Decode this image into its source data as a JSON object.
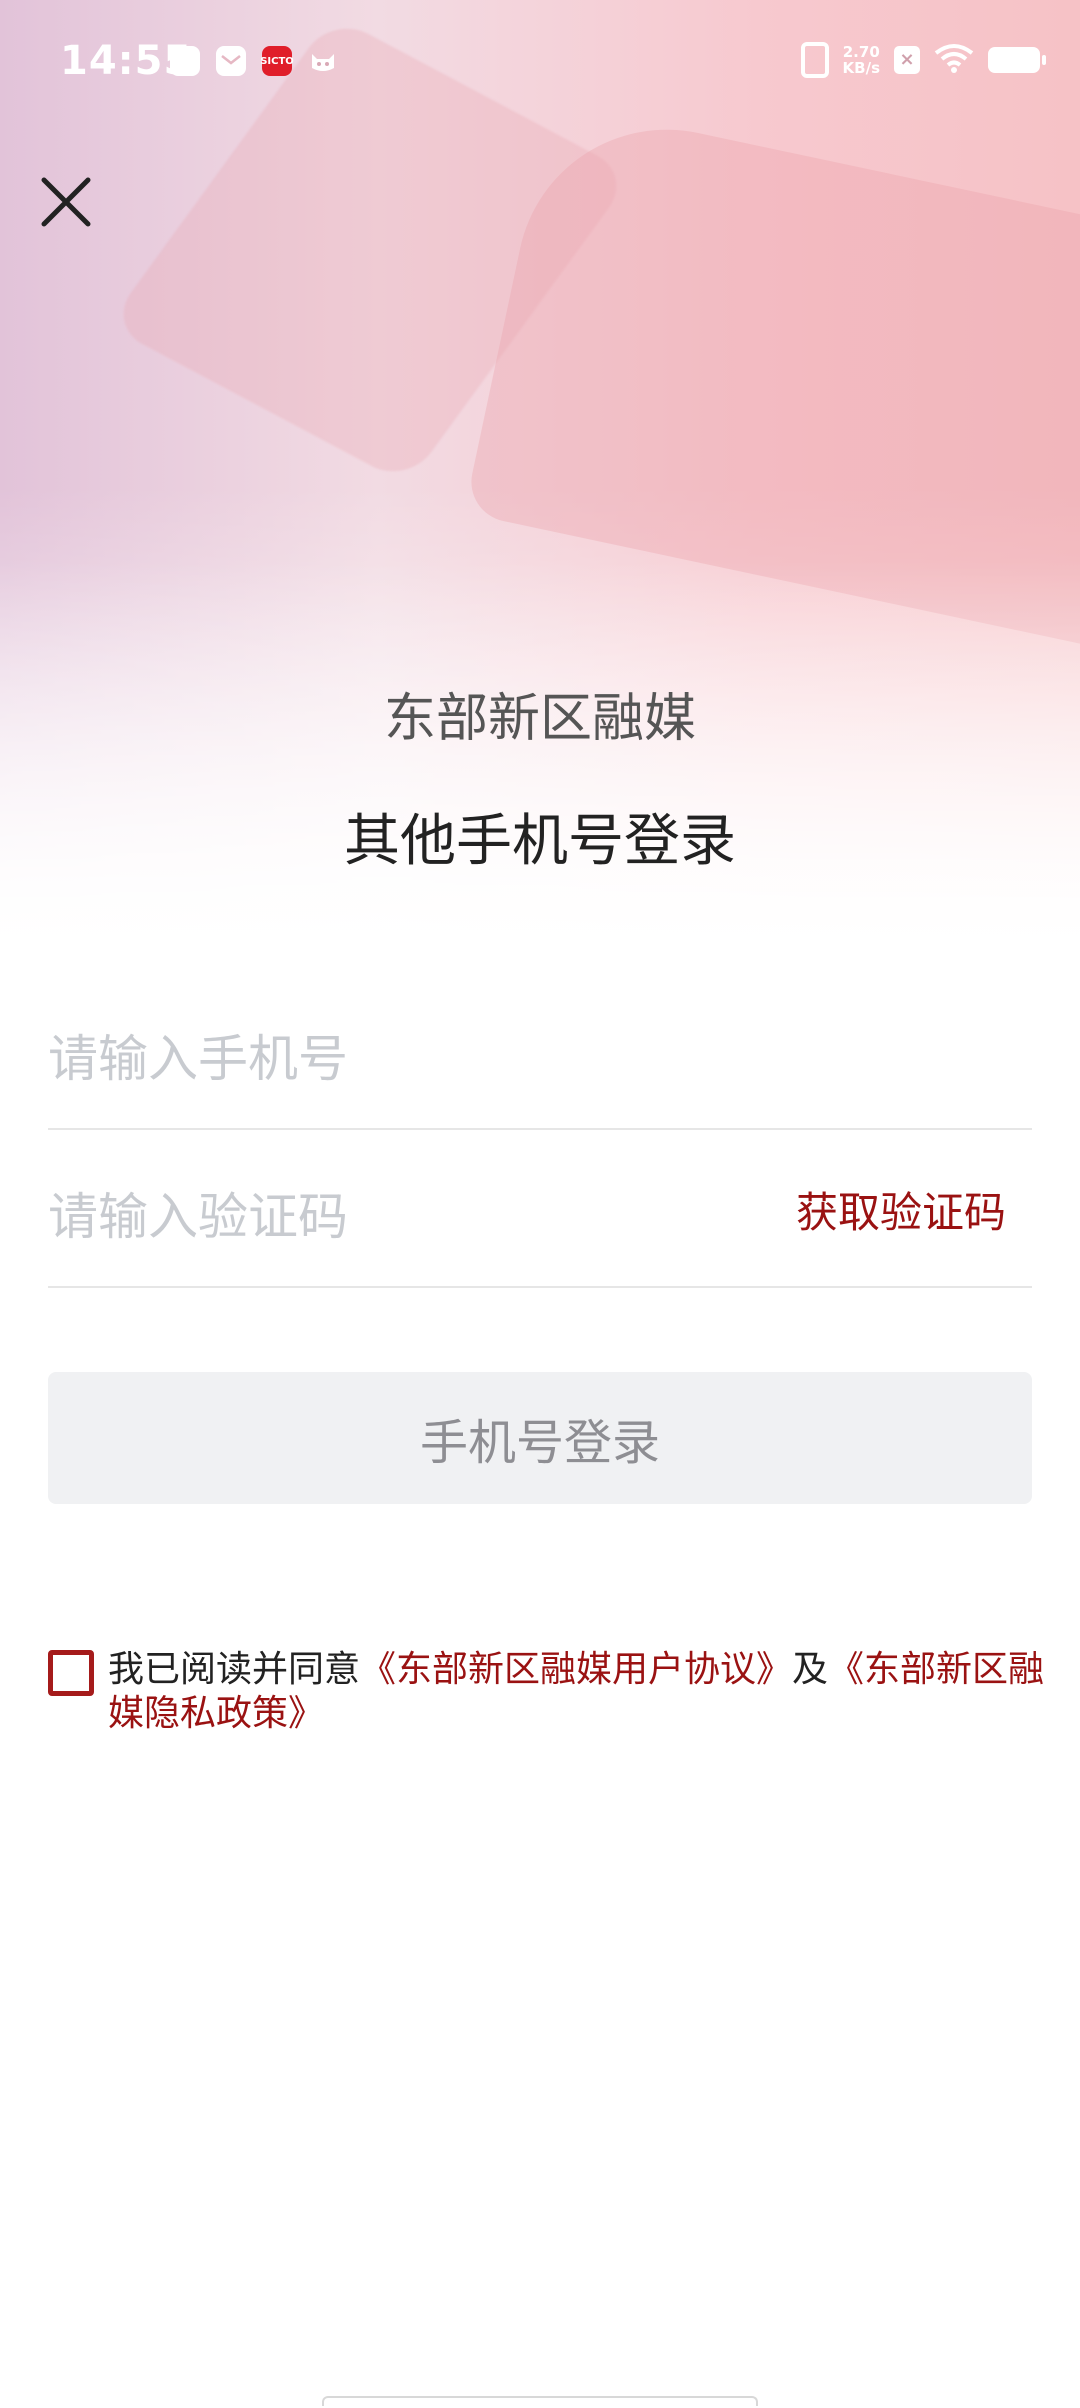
{
  "status_bar": {
    "time": "14:55",
    "notif_icon_3": "SICTO",
    "net_speed_value": "2.70",
    "net_speed_unit": "KB/s"
  },
  "header": {
    "brand": "东部新区融媒",
    "title": "其他手机号登录"
  },
  "form": {
    "phone_placeholder": "请输入手机号",
    "code_placeholder": "请输入验证码",
    "get_code_label": "获取验证码",
    "login_label": "手机号登录"
  },
  "agreement": {
    "prefix": "我已阅读并同意",
    "user_agreement": "《东部新区融媒用户协议》",
    "and": "及",
    "privacy_policy": "《东部新区融媒隐私政策》"
  },
  "colors": {
    "accent": "#9a1212",
    "placeholder": "#c8cbd0",
    "button_bg": "#f0f1f3"
  },
  "icons": [
    "close-icon",
    "checkbox-icon",
    "wifi-icon",
    "battery-icon",
    "vibrate-icon"
  ]
}
